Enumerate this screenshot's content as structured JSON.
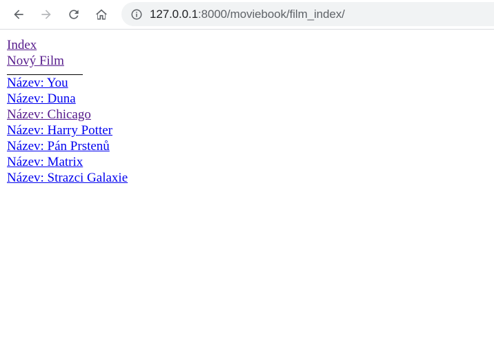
{
  "browser": {
    "url_host": "127.0.0.1",
    "url_path": ":8000/moviebook/film_index/"
  },
  "nav": {
    "index_label": "Index",
    "new_film_label": "Nový Film"
  },
  "films": [
    {
      "label": "Název: You"
    },
    {
      "label": "Název: Duna"
    },
    {
      "label": "Název: Chicago"
    },
    {
      "label": "Název: Harry Potter"
    },
    {
      "label": "Název: Pán Prstenů"
    },
    {
      "label": "Název: Matrix"
    },
    {
      "label": "Název: Strazci Galaxie"
    }
  ],
  "colors": {
    "link": "#0000ee",
    "visited_link": "#551a8b",
    "omnibox_bg": "#f1f3f4"
  },
  "icons": [
    "back-arrow-icon",
    "forward-arrow-icon",
    "reload-icon",
    "home-icon",
    "info-icon"
  ]
}
